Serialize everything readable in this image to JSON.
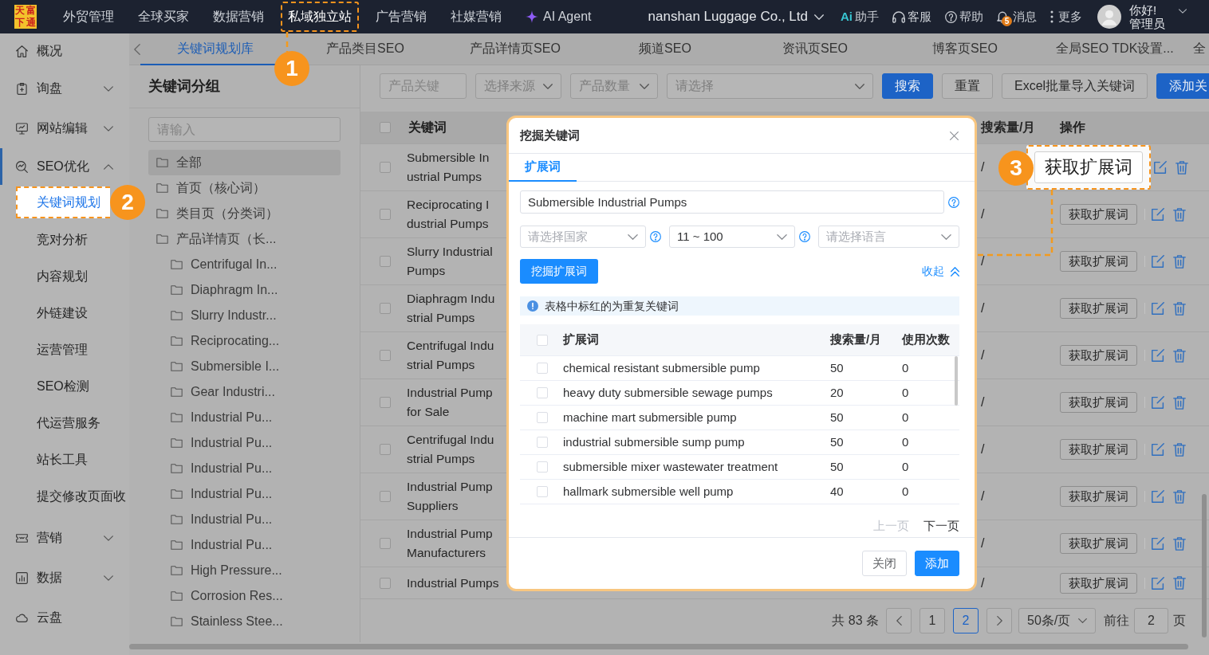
{
  "logo": [
    "天",
    "富",
    "下",
    "通"
  ],
  "top_nav": [
    {
      "label": "外贸管理",
      "kind": "text",
      "selected": false
    },
    {
      "label": "全球买家",
      "kind": "text",
      "selected": false
    },
    {
      "label": "数据营销",
      "kind": "text",
      "selected": false
    },
    {
      "label": "私域独立站",
      "kind": "text",
      "selected": true,
      "callout": "1"
    },
    {
      "label": "广告营销",
      "kind": "text",
      "selected": false
    },
    {
      "label": "社媒营销",
      "kind": "text",
      "selected": false
    },
    {
      "label": "AI Agent",
      "kind": "ai",
      "selected": false
    }
  ],
  "company": "nanshan Luggage Co., Ltd",
  "header_tools": [
    {
      "kind": "ai",
      "mark": "Ai",
      "label": "助手"
    },
    {
      "kind": "headset",
      "label": "客服"
    },
    {
      "kind": "help",
      "label": "帮助"
    },
    {
      "kind": "bell",
      "label": "消息",
      "badge": "5"
    },
    {
      "kind": "more",
      "label": "更多"
    }
  ],
  "user": {
    "greeting": "你好!",
    "role": "管理员"
  },
  "sidebar": [
    {
      "label": "概况"
    },
    {
      "label": "询盘",
      "expanded": false
    },
    {
      "label": "网站编辑",
      "expanded": false
    },
    {
      "label": "SEO优化",
      "expanded": true,
      "children": [
        {
          "label": "关键词规划",
          "selected": true,
          "callout": "2"
        },
        {
          "label": "竞对分析",
          "selected": false
        },
        {
          "label": "内容规划",
          "selected": false
        },
        {
          "label": "外链建设",
          "selected": false
        },
        {
          "label": "运营管理",
          "selected": false
        },
        {
          "label": "SEO检测",
          "selected": false
        },
        {
          "label": "代运营服务",
          "selected": false
        },
        {
          "label": "站长工具",
          "selected": false
        },
        {
          "label": "提交修改页面收",
          "selected": false
        }
      ]
    },
    {
      "label": "营销",
      "expanded": false
    },
    {
      "label": "数据",
      "expanded": false
    },
    {
      "label": "云盘"
    }
  ],
  "page_tabs": [
    {
      "label": "关键词规划库",
      "selected": true
    },
    {
      "label": "产品类目SEO",
      "selected": false
    },
    {
      "label": "产品详情页SEO",
      "selected": false
    },
    {
      "label": "频道SEO",
      "selected": false
    },
    {
      "label": "资讯页SEO",
      "selected": false
    },
    {
      "label": "博客页SEO",
      "selected": false
    },
    {
      "label": "全局SEO TDK设置...",
      "selected": false
    },
    {
      "label": "全",
      "selected": false
    }
  ],
  "keyword_groups": {
    "title": "关键词分组",
    "search_placeholder": "请输入",
    "tree": [
      {
        "label": "全部",
        "selected": true
      },
      {
        "label": "首页（核心词）",
        "selected": false
      },
      {
        "label": "类目页（分类词）",
        "selected": false
      },
      {
        "label": "产品详情页（长...",
        "selected": false,
        "children": [
          {
            "label": "Centrifugal In...",
            "selected": false
          },
          {
            "label": "Diaphragm In...",
            "selected": false
          },
          {
            "label": "Slurry Industr...",
            "selected": false
          },
          {
            "label": "Reciprocating...",
            "selected": false
          },
          {
            "label": "Submersible I...",
            "selected": false
          },
          {
            "label": "Gear Industri...",
            "selected": false
          },
          {
            "label": "Industrial Pu...",
            "selected": false
          },
          {
            "label": "Industrial Pu...",
            "selected": false
          },
          {
            "label": "Industrial Pu...",
            "selected": false
          },
          {
            "label": "Industrial Pu...",
            "selected": false
          },
          {
            "label": "Industrial Pu...",
            "selected": false
          },
          {
            "label": "Industrial Pu...",
            "selected": false
          },
          {
            "label": "High Pressure...",
            "selected": false
          },
          {
            "label": "Corrosion Res...",
            "selected": false
          },
          {
            "label": "Stainless Stee...",
            "selected": false
          }
        ]
      }
    ]
  },
  "filters": [
    {
      "kind": "input",
      "placeholder": "产品关键"
    },
    {
      "kind": "select",
      "placeholder": "选择来源"
    },
    {
      "kind": "select",
      "placeholder": "产品数量"
    },
    {
      "kind": "select",
      "placeholder": "请选择"
    }
  ],
  "toolbar_buttons": [
    {
      "label": "搜索",
      "kind": "primary"
    },
    {
      "label": "重置",
      "kind": "default"
    },
    {
      "label": "Excel批量导入关键词",
      "kind": "default"
    },
    {
      "label": "添加关",
      "kind": "primary"
    }
  ],
  "table": {
    "columns": [
      "关键词",
      "搜索量/月",
      "操作"
    ],
    "all_checked": false,
    "rows": [
      {
        "keyword": "Submersible In\nustrial Pumps",
        "volume": "/",
        "action": "获取扩展词",
        "checked": false,
        "callout": "3"
      },
      {
        "keyword": "Reciprocating I\ndustrial Pumps",
        "volume": "/",
        "action": "获取扩展词",
        "checked": false
      },
      {
        "keyword": "Slurry Industrial\nPumps",
        "volume": "/",
        "action": "获取扩展词",
        "checked": false
      },
      {
        "keyword": "Diaphragm Indu\nstrial Pumps",
        "volume": "/",
        "action": "获取扩展词",
        "checked": false
      },
      {
        "keyword": "Centrifugal Indu\nstrial Pumps",
        "volume": "/",
        "action": "获取扩展词",
        "checked": false
      },
      {
        "keyword": "Industrial Pump\nfor Sale",
        "volume": "/",
        "action": "获取扩展词",
        "checked": false
      },
      {
        "keyword": "Centrifugal Indu\nstrial Pumps",
        "volume": "/",
        "action": "获取扩展词",
        "checked": false
      },
      {
        "keyword": "Industrial Pump\nSuppliers",
        "volume": "/",
        "action": "获取扩展词",
        "checked": false
      },
      {
        "keyword": "Industrial Pump\nManufacturers",
        "volume": "/",
        "action": "获取扩展词",
        "checked": false
      },
      {
        "keyword": "Industrial Pumps",
        "volume": "/",
        "action": "获取扩展词",
        "checked": false
      }
    ]
  },
  "pagination": {
    "total": "共 83 条",
    "pages": [
      {
        "label": "1",
        "selected": false
      },
      {
        "label": "2",
        "selected": true
      }
    ],
    "page_size": "50条/页",
    "goto_label": "前往",
    "goto_value": "2",
    "page_suffix": "页"
  },
  "dialog": {
    "title": "挖掘关键词",
    "tabs": [
      {
        "label": "扩展词",
        "selected": true
      }
    ],
    "keyword": {
      "value": "Submersible Industrial Pumps",
      "help": true
    },
    "selects": [
      {
        "placeholder": "请选择国家",
        "help": true
      },
      {
        "value": "11 ~ 100",
        "help": true
      },
      {
        "placeholder": "请选择语言",
        "help": false
      }
    ],
    "dig_button": "挖掘扩展词",
    "collapse_link": "收起",
    "notice": "表格中标红的为重复关键词",
    "table": {
      "columns": [
        "扩展词",
        "搜索量/月",
        "使用次数"
      ],
      "all_checked": false,
      "rows": [
        {
          "keyword": "chemical resistant submersible pump",
          "volume": "50",
          "uses": "0",
          "checked": false
        },
        {
          "keyword": "heavy duty submersible sewage pumps",
          "volume": "20",
          "uses": "0",
          "checked": false
        },
        {
          "keyword": "machine mart submersible pump",
          "volume": "50",
          "uses": "0",
          "checked": false
        },
        {
          "keyword": "industrial submersible sump pump",
          "volume": "50",
          "uses": "0",
          "checked": false
        },
        {
          "keyword": "submersible mixer wastewater treatment",
          "volume": "50",
          "uses": "0",
          "checked": false
        },
        {
          "keyword": "hallmark submersible well pump",
          "volume": "40",
          "uses": "0",
          "checked": false
        }
      ]
    },
    "prev_page": {
      "label": "上一页",
      "disabled": true
    },
    "next_page": {
      "label": "下一页",
      "disabled": false
    },
    "buttons": [
      {
        "label": "关闭",
        "kind": "default"
      },
      {
        "label": "添加",
        "kind": "primary"
      }
    ]
  }
}
